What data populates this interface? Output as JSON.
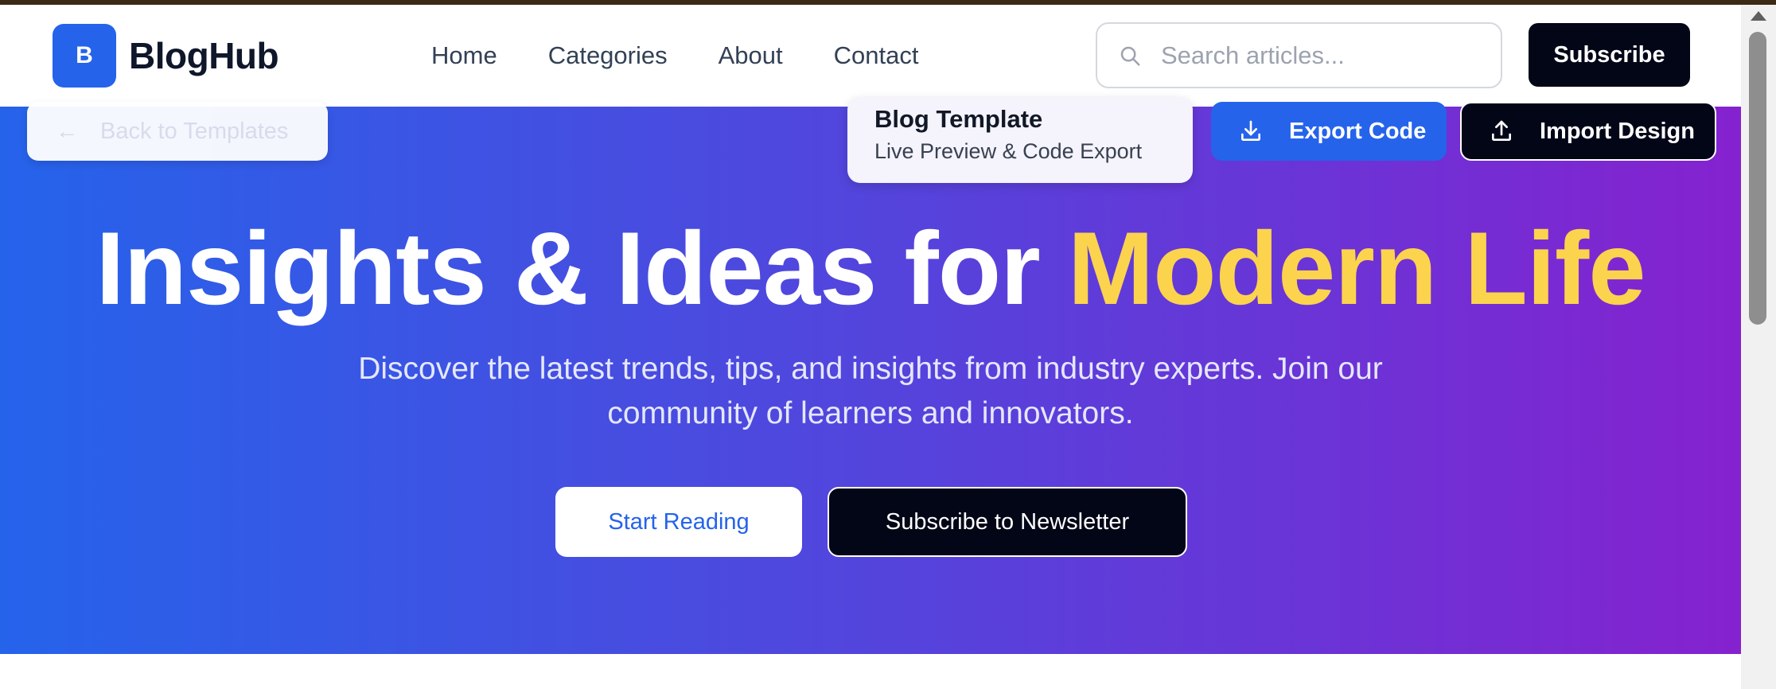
{
  "brand": {
    "logo_letter": "B",
    "name": "BlogHub"
  },
  "nav": {
    "links": [
      "Home",
      "Categories",
      "About",
      "Contact"
    ]
  },
  "search": {
    "placeholder": "Search articles...",
    "value": ""
  },
  "header_subscribe": "Subscribe",
  "toolbar": {
    "back_label": "Back to Templates",
    "template_title": "Blog Template",
    "template_subtitle": "Live Preview & Code Export",
    "export_label": "Export Code",
    "import_label": "Import Design"
  },
  "hero": {
    "title_main": "Insights & Ideas for",
    "title_accent": "Modern Life",
    "subtitle": "Discover the latest trends, tips, and insights from industry experts. Join our community of learners and innovators.",
    "primary_cta": "Start Reading",
    "secondary_cta": "Subscribe to Newsletter"
  },
  "colors": {
    "accent": "#2563eb",
    "highlight": "#fcd34d",
    "dark": "#020617",
    "gradient_start": "#2563eb",
    "gradient_end": "#8522cf"
  },
  "icons": [
    "search-icon",
    "arrow-left-icon",
    "download-icon",
    "upload-icon"
  ]
}
